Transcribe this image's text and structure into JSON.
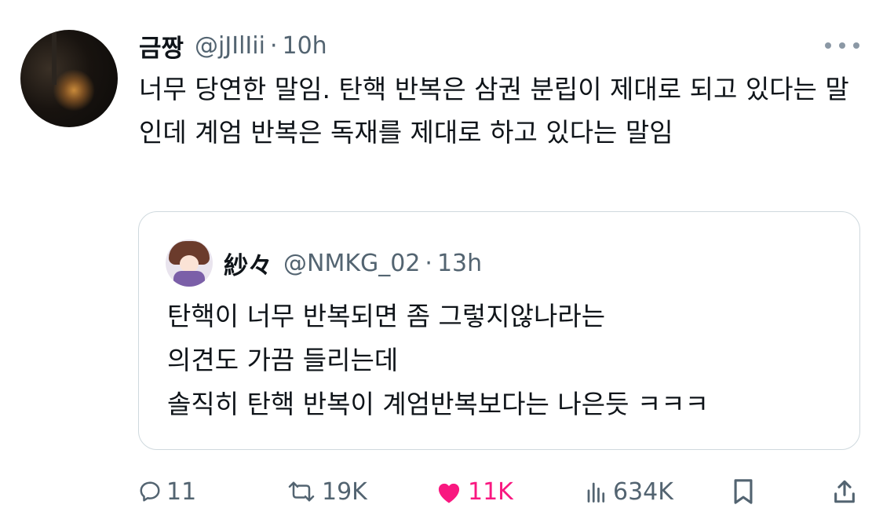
{
  "tweet": {
    "author_name": "금짱",
    "author_handle": "@jJIlIii",
    "separator": "·",
    "time": "10h",
    "more_icon": "ellipsis-icon",
    "text": "너무 당연한 말임. 탄핵 반복은 삼권 분립이 제대로 되고 있다는 말인데 계엄 반복은 독재를 제대로 하고 있다는 말임"
  },
  "quote": {
    "author_name": "紗々",
    "author_handle": "@NMKG_02",
    "separator": "·",
    "time": "13h",
    "lines": [
      "탄핵이 너무 반복되면 좀 그렇지않나라는",
      "의견도 가끔 들리는데",
      "솔직히 탄핵 반복이 계엄반복보다는 나은듯 ㅋㅋㅋ"
    ]
  },
  "actions": {
    "reply": {
      "icon": "reply-icon",
      "count": "11"
    },
    "retweet": {
      "icon": "retweet-icon",
      "count": "19K"
    },
    "like": {
      "icon": "heart-icon",
      "count": "11K",
      "color": "#f91880",
      "active": true
    },
    "views": {
      "icon": "views-icon",
      "count": "634K"
    },
    "bookmark": {
      "icon": "bookmark-icon"
    },
    "share": {
      "icon": "share-icon"
    }
  },
  "colors": {
    "text": "#0f1419",
    "secondary": "#536471",
    "border": "#cfd9de",
    "like": "#f91880"
  }
}
